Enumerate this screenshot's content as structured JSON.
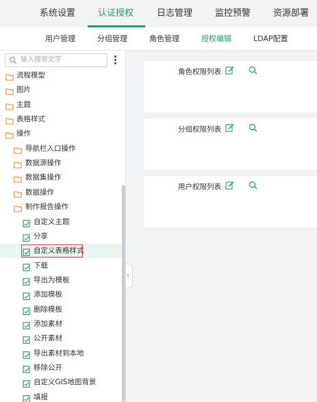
{
  "top_tabs": [
    {
      "label": "系统设置",
      "active": false
    },
    {
      "label": "认证授权",
      "active": true
    },
    {
      "label": "日志管理",
      "active": false
    },
    {
      "label": "监控预警",
      "active": false
    },
    {
      "label": "资源部署",
      "active": false
    }
  ],
  "sub_tabs": [
    {
      "label": "用户管理",
      "active": false
    },
    {
      "label": "分组管理",
      "active": false
    },
    {
      "label": "角色管理",
      "active": false
    },
    {
      "label": "授权编辑",
      "active": true
    },
    {
      "label": "LDAP配置",
      "active": false
    }
  ],
  "search": {
    "placeholder": "输入搜索文字"
  },
  "tree": [
    {
      "label": "流程模型",
      "type": "folder"
    },
    {
      "label": "图片",
      "type": "folder"
    },
    {
      "label": "主题",
      "type": "folder"
    },
    {
      "label": "表格样式",
      "type": "folder"
    },
    {
      "label": "操作",
      "type": "folder"
    },
    {
      "label": "导航栏入口操作",
      "type": "folder"
    },
    {
      "label": "数据源操作",
      "type": "folder"
    },
    {
      "label": "数据集操作",
      "type": "folder"
    },
    {
      "label": "数据操作",
      "type": "folder"
    },
    {
      "label": "制作报告操作",
      "type": "folder"
    },
    {
      "label": "自定义主题",
      "type": "item"
    },
    {
      "label": "分享",
      "type": "item"
    },
    {
      "label": "自定义表格样式",
      "type": "item",
      "selected": true
    },
    {
      "label": "下载",
      "type": "item"
    },
    {
      "label": "导出为模板",
      "type": "item"
    },
    {
      "label": "添加模板",
      "type": "item"
    },
    {
      "label": "删除模板",
      "type": "item"
    },
    {
      "label": "添加素材",
      "type": "item"
    },
    {
      "label": "公开素材",
      "type": "item"
    },
    {
      "label": "导出素材到本地",
      "type": "item"
    },
    {
      "label": "移除公开",
      "type": "item"
    },
    {
      "label": "自定义GIS地图背景",
      "type": "item"
    },
    {
      "label": "填报",
      "type": "item"
    }
  ],
  "panels": [
    {
      "title": "角色权限列表"
    },
    {
      "title": "分组权限列表"
    },
    {
      "title": "用户权限列表"
    }
  ],
  "colors": {
    "accent": "#1e9c65",
    "folder": "#e08a2e",
    "item_icon": "#2e8b57",
    "selection_border": "#d9363e"
  }
}
